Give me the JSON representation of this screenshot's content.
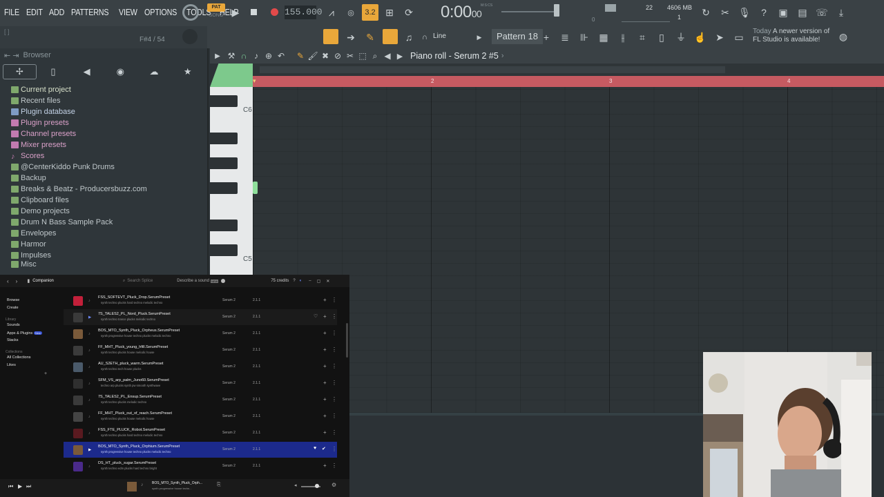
{
  "menu": [
    "FILE",
    "EDIT",
    "ADD",
    "PATTERNS",
    "VIEW",
    "OPTIONS",
    "TOOLS",
    "HELP"
  ],
  "transport": {
    "pat_label": "PAT",
    "song_label": "SONG",
    "bpm": "155.000",
    "time": "0:00",
    "time_sub": "00",
    "time_caption": "M:S:CS",
    "beat_label": "3.2"
  },
  "monitor": {
    "cpu": "22",
    "ram": "4606 MB",
    "poly": "1",
    "zero": "0"
  },
  "hint": {
    "note_info": "F#4 / 54"
  },
  "pattern": {
    "snap": "Line",
    "name": "Pattern 18"
  },
  "news": {
    "when": "Today",
    "text": "A newer version of FL Studio is available!"
  },
  "browser": {
    "title": "Browser",
    "items": [
      "Current project",
      "Recent files",
      "Plugin database",
      "Plugin presets",
      "Channel presets",
      "Mixer presets",
      "Scores",
      "@CenterKiddo Punk Drums",
      "Backup",
      "Breaks & Beatz - Producersbuzz.com",
      "Clipboard files",
      "Demo projects",
      "Drum N Bass Sample Pack",
      "Envelopes",
      "Harmor",
      "Impulses",
      "Misc"
    ]
  },
  "piano_roll": {
    "title": "Piano roll - Serum 2 #5",
    "ruler": [
      "2",
      "3",
      "4"
    ],
    "key_labels": [
      "C6",
      "C5"
    ]
  },
  "companion": {
    "title": "Companion",
    "search_placeholder": "Search Splice",
    "describe": "Describe a sound",
    "describe_badge": "NEW",
    "credits": "75 credits",
    "nav": [
      "Browse",
      "Create"
    ],
    "library_head": "Library",
    "library": [
      "Sounds",
      "Apps & Plugins",
      "Stacks"
    ],
    "apps_badge": "New",
    "collections_head": "Collections",
    "collections": [
      "All Collections",
      "Likes"
    ],
    "rows": [
      {
        "name": "FSS_SOFTEVT_Pluck_Drop.SerumPreset",
        "tags": "synth  techno  plucks  hard techno  melodic techno",
        "synth": "Serum 2",
        "ver": "2.1.1"
      },
      {
        "name": "7S_TALES2_PL_Nord_Pluck.SerumPreset",
        "tags": "synth  techno  trance  plucks  melodic techno",
        "synth": "Serum 2",
        "ver": "2.1.1"
      },
      {
        "name": "BOS_MTO_Synth_Pluck_Orpheus.SerumPreset",
        "tags": "synth  progressive house  techno  plucks  melodic techno",
        "synth": "Serum 2",
        "ver": "2.1.1"
      },
      {
        "name": "FF_MHT_Pluck_young_hfill.SerumPreset",
        "tags": "synth  techno  plucks  house  melodic house",
        "synth": "Serum 2",
        "ver": "2.1.1"
      },
      {
        "name": "AU_S2ETH_pluck_warm.SerumPreset",
        "tags": "synth  techno  tech house  plucks",
        "synth": "Serum 2",
        "ver": "2.1.1"
      },
      {
        "name": "SFM_VS_arp_palm_Juno60.SerumPreset",
        "tags": "techno  arp  plucks  synth  pw  smooth  synthwave",
        "synth": "Serum 2",
        "ver": "2.1.1"
      },
      {
        "name": "7S_TALES2_PL_Ensup.SerumPreset",
        "tags": "synth  techno  plucks  melodic techno",
        "synth": "Serum 2",
        "ver": "2.1.1"
      },
      {
        "name": "FF_MHT_Pluck_out_of_reach.SerumPreset",
        "tags": "synth  techno  plucks  house  melodic house",
        "synth": "Serum 2",
        "ver": "2.1.1"
      },
      {
        "name": "FSS_FTE_PLUCK_Robot.SerumPreset",
        "tags": "synth  techno  plucks  hard techno  melodic techno",
        "synth": "Serum 2",
        "ver": "2.1.1"
      },
      {
        "name": "BOS_MTO_Synth_Pluck_Orphium.SerumPreset",
        "tags": "synth  progressive house  techno  plucks  melodic techno",
        "synth": "Serum 2",
        "ver": "2.1.1"
      },
      {
        "name": "DS_HT_pluck_sugar.SerumPreset",
        "tags": "synth  techno  edm  plucks  hard techno  bright",
        "synth": "Serum 2",
        "ver": "2.1.1"
      }
    ],
    "now_playing": {
      "name": "BOS_MTO_Synth_Pluck_Orph...",
      "tags": "synth  progressive house  techn..."
    }
  },
  "colors": {
    "accent": "#e9a73a",
    "ruler": "#c65a61",
    "note": "#8fdf9b",
    "selected_row": "#1c2a8c"
  }
}
